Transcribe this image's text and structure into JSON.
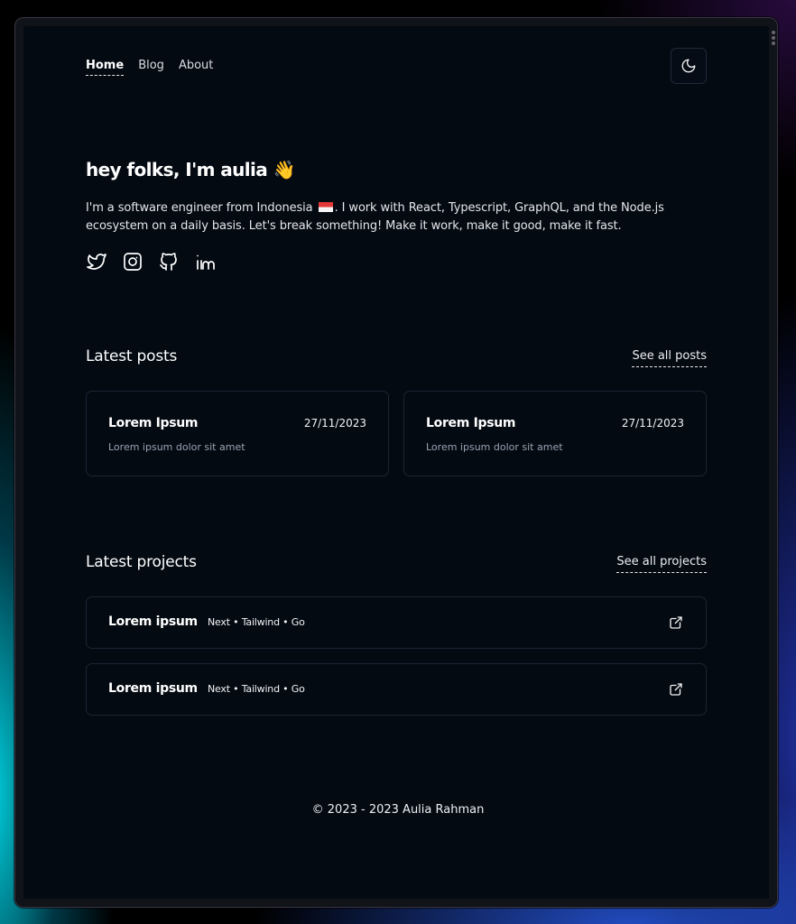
{
  "nav": {
    "items": [
      {
        "label": "Home",
        "active": true
      },
      {
        "label": "Blog",
        "active": false
      },
      {
        "label": "About",
        "active": false
      }
    ],
    "theme_toggle_icon": "moon-icon"
  },
  "hero": {
    "title": "hey folks, I'm aulia 👋",
    "bio_part1": "I'm a software engineer from Indonesia",
    "bio_flag_icon": "indonesia-flag-icon",
    "bio_part2": ". I work with React, Typescript, GraphQL, and the Node.js ecosystem on a daily basis. Let's break something! Make it work, make it good, make it fast.",
    "socials": [
      "twitter-icon",
      "instagram-icon",
      "github-icon",
      "linkedin-icon"
    ]
  },
  "posts": {
    "title": "Latest posts",
    "see_all": "See all posts",
    "items": [
      {
        "title": "Lorem Ipsum",
        "date": "27/11/2023",
        "description": "Lorem ipsum dolor sit amet"
      },
      {
        "title": "Lorem Ipsum",
        "date": "27/11/2023",
        "description": "Lorem ipsum dolor sit amet"
      }
    ]
  },
  "projects": {
    "title": "Latest projects",
    "see_all": "See all projects",
    "items": [
      {
        "title": "Lorem ipsum",
        "tech": "Next • Tailwind • Go",
        "icon": "external-link-icon"
      },
      {
        "title": "Lorem ipsum",
        "tech": "Next • Tailwind • Go",
        "icon": "external-link-icon"
      }
    ]
  },
  "footer": {
    "text": "© 2023 - 2023 Aulia Rahman"
  },
  "colors": {
    "background": "#040a12",
    "card_border": "#1b2533",
    "text_primary": "#ffffff",
    "text_muted": "#9aa3b2"
  }
}
